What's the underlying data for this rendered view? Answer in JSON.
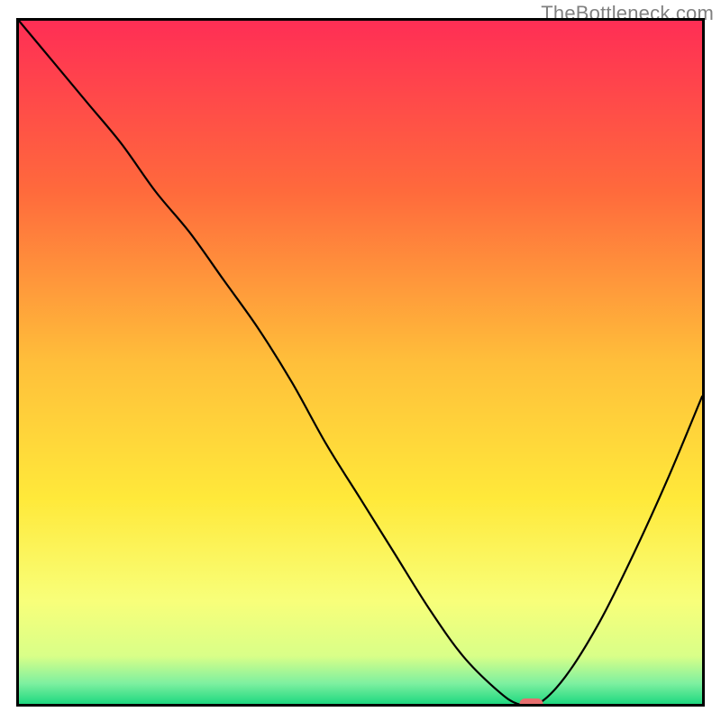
{
  "watermark": "TheBottleneck.com",
  "chart_data": {
    "type": "line",
    "title": "",
    "xlabel": "",
    "ylabel": "",
    "xlim": [
      0,
      100
    ],
    "ylim": [
      0,
      100
    ],
    "series": [
      {
        "name": "bottleneck-curve",
        "x": [
          0,
          5,
          10,
          15,
          20,
          25,
          30,
          35,
          40,
          45,
          50,
          55,
          60,
          65,
          70,
          73,
          76,
          80,
          85,
          90,
          95,
          100
        ],
        "values": [
          100,
          94,
          88,
          82,
          75,
          69,
          62,
          55,
          47,
          38,
          30,
          22,
          14,
          7,
          2,
          0,
          0,
          4,
          12,
          22,
          33,
          45
        ]
      }
    ],
    "marker": {
      "x": 75,
      "y": 0,
      "color": "#e76f6f"
    },
    "background_gradient": {
      "top": "#ff2e55",
      "mid1": "#ff8a3c",
      "mid2": "#ffd83a",
      "mid3": "#fff86a",
      "bottom": "#26e08a"
    }
  }
}
